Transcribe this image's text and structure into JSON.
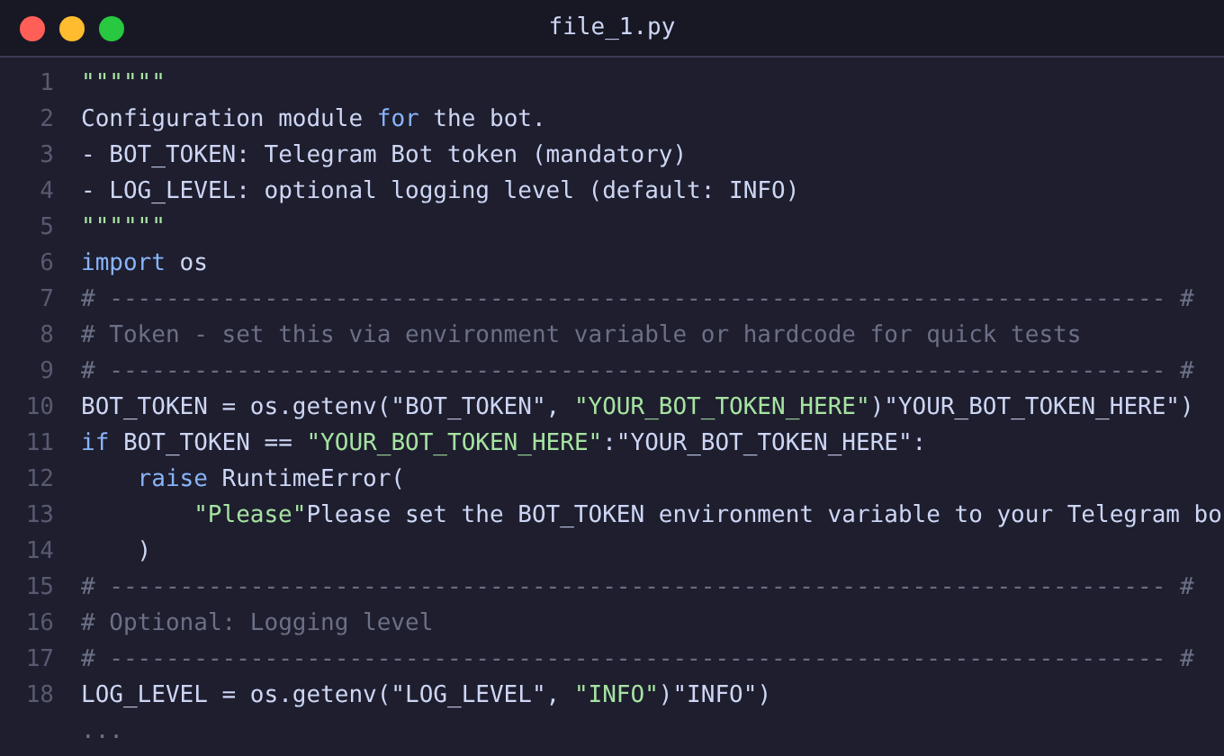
{
  "window": {
    "title": "file_1.py",
    "controls": [
      {
        "color": "#ff5f57"
      },
      {
        "color": "#febc2e"
      },
      {
        "color": "#28c840"
      }
    ]
  },
  "lines": [
    {
      "number": "1",
      "tokens": [
        {
          "kind": "string",
          "text": "\"\"\"\"\"\""
        }
      ]
    },
    {
      "number": "2",
      "tokens": [
        {
          "kind": "plain",
          "text": "Configuration module "
        },
        {
          "kind": "keyword",
          "text": "for"
        },
        {
          "kind": "plain",
          "text": " the bot."
        }
      ]
    },
    {
      "number": "3",
      "tokens": [
        {
          "kind": "plain",
          "text": "- BOT_TOKEN: Telegram Bot token (mandatory)"
        }
      ]
    },
    {
      "number": "4",
      "tokens": [
        {
          "kind": "plain",
          "text": "- LOG_LEVEL: optional logging level (default: INFO)"
        }
      ]
    },
    {
      "number": "5",
      "tokens": [
        {
          "kind": "string",
          "text": "\"\"\"\"\"\""
        }
      ]
    },
    {
      "number": "6",
      "tokens": [
        {
          "kind": "keyword",
          "text": "import"
        },
        {
          "kind": "plain",
          "text": " os"
        }
      ]
    },
    {
      "number": "7",
      "tokens": [
        {
          "kind": "comment",
          "text": "# --------------------------------------------------------------------------- #"
        }
      ]
    },
    {
      "number": "8",
      "tokens": [
        {
          "kind": "comment",
          "text": "# Token - set this via environment variable or hardcode for quick tests"
        }
      ]
    },
    {
      "number": "9",
      "tokens": [
        {
          "kind": "comment",
          "text": "# --------------------------------------------------------------------------- #"
        }
      ]
    },
    {
      "number": "10",
      "tokens": [
        {
          "kind": "plain",
          "text": "BOT_TOKEN = os.getenv(\"BOT_TOKEN\", "
        },
        {
          "kind": "string",
          "text": "\"YOUR_BOT_TOKEN_HERE\""
        },
        {
          "kind": "plain",
          "text": ")\"YOUR_BOT_TOKEN_HERE\")"
        }
      ]
    },
    {
      "number": "11",
      "tokens": [
        {
          "kind": "keyword",
          "text": "if"
        },
        {
          "kind": "plain",
          "text": " BOT_TOKEN == "
        },
        {
          "kind": "string",
          "text": "\"YOUR_BOT_TOKEN_HERE\""
        },
        {
          "kind": "plain",
          "text": ":\"YOUR_BOT_TOKEN_HERE\":"
        }
      ],
      "children": [
        {
          "number": "12",
          "tokens": [
            {
              "kind": "keyword",
              "text": "raise"
            },
            {
              "kind": "plain",
              "text": " RuntimeError("
            }
          ],
          "children": [
            {
              "number": "13",
              "tokens": [
                {
                  "kind": "string",
                  "text": "\"Please\""
                },
                {
                  "kind": "plain",
                  "text": "Please set the BOT_TOKEN environment variable to your Telegram bo"
                }
              ]
            }
          ]
        },
        {
          "number": "14",
          "tokens": [
            {
              "kind": "plain",
              "text": ")"
            }
          ]
        }
      ]
    },
    {
      "number": "15",
      "tokens": [
        {
          "kind": "comment",
          "text": "# --------------------------------------------------------------------------- #"
        }
      ]
    },
    {
      "number": "16",
      "tokens": [
        {
          "kind": "comment",
          "text": "# Optional: Logging level"
        }
      ]
    },
    {
      "number": "17",
      "tokens": [
        {
          "kind": "comment",
          "text": "# --------------------------------------------------------------------------- #"
        }
      ]
    },
    {
      "number": "18",
      "tokens": [
        {
          "kind": "plain",
          "text": "LOG_LEVEL = os.getenv(\"LOG_LEVEL\", "
        },
        {
          "kind": "string",
          "text": "\"INFO\""
        },
        {
          "kind": "plain",
          "text": ")\"INFO\")"
        }
      ]
    },
    {
      "tokens": [
        {
          "kind": "comment",
          "text": "..."
        }
      ]
    }
  ]
}
